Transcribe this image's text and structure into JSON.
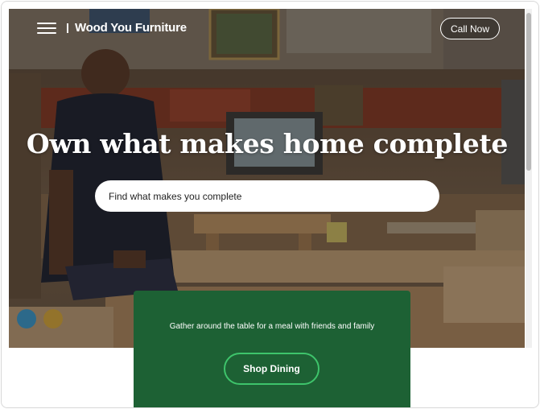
{
  "header": {
    "brand": "Wood You Furniture",
    "call_label": "Call Now",
    "menu_icon": "hamburger-menu-icon"
  },
  "hero": {
    "headline": "Own what makes home complete",
    "search_placeholder": "Find what makes you complete"
  },
  "promo": {
    "text": "Gather around the table for a meal with friends and family",
    "button_label": "Shop Dining"
  },
  "colors": {
    "promo_green": "#1d6134",
    "button_border": "#3ec46b"
  }
}
